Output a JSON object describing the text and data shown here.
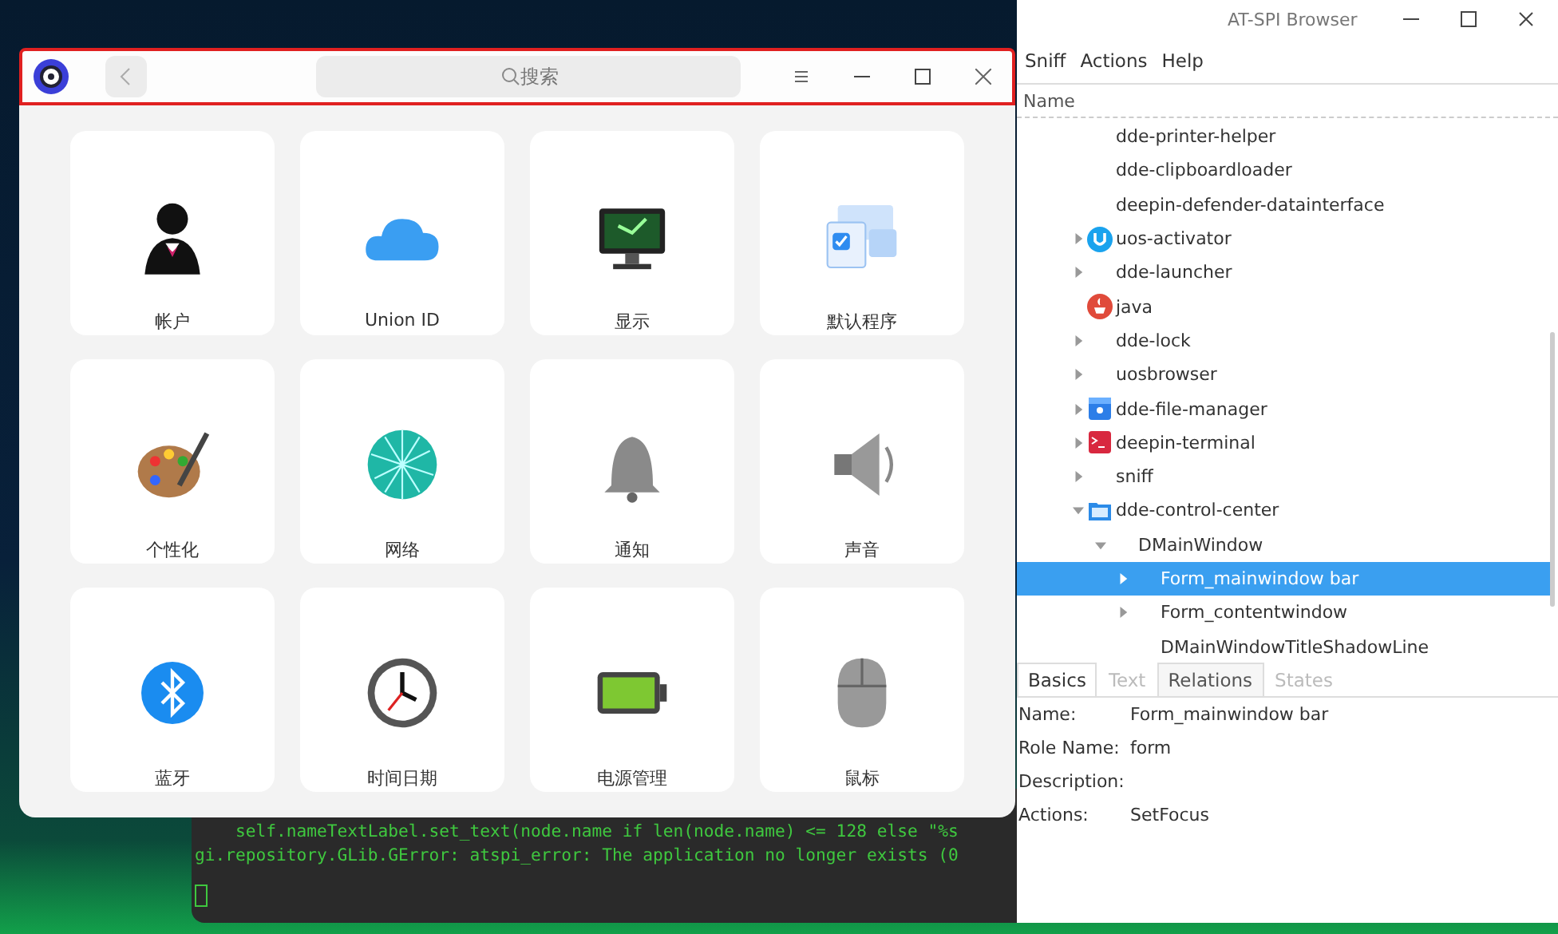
{
  "control_center": {
    "search": {
      "placeholder": "搜索"
    },
    "tiles": [
      {
        "label": "帐户"
      },
      {
        "label": "Union ID"
      },
      {
        "label": "显示"
      },
      {
        "label": "默认程序"
      },
      {
        "label": "个性化"
      },
      {
        "label": "网络"
      },
      {
        "label": "通知"
      },
      {
        "label": "声音"
      },
      {
        "label": "蓝牙"
      },
      {
        "label": "时间日期"
      },
      {
        "label": "电源管理"
      },
      {
        "label": "鼠标"
      }
    ]
  },
  "terminal": {
    "lines": [
      "    self.nameTextLabel.set_text(node.name if len(node.name) <= 128 else \"%s",
      "gi.repository.GLib.GError: atspi_error: The application no longer exists (0"
    ]
  },
  "atspi_browser": {
    "window": {
      "title": "AT-SPI Browser"
    },
    "menu": [
      "Sniff",
      "Actions",
      "Help"
    ],
    "tree": {
      "column": "Name",
      "items": [
        {
          "label": "dde-printer-helper",
          "selected": false
        },
        {
          "label": "dde-clipboardloader",
          "selected": false
        },
        {
          "label": "deepin-defender-datainterface",
          "selected": false
        },
        {
          "label": "uos-activator",
          "kind": "activator",
          "expanded": false,
          "selected": false
        },
        {
          "label": "dde-launcher",
          "expanded": false,
          "selected": false
        },
        {
          "label": "java",
          "kind": "java",
          "selected": false
        },
        {
          "label": "dde-lock",
          "expanded": false,
          "selected": false
        },
        {
          "label": "uosbrowser",
          "expanded": false,
          "selected": false
        },
        {
          "label": "dde-file-manager",
          "kind": "file-manager",
          "expanded": false,
          "selected": false
        },
        {
          "label": "deepin-terminal",
          "kind": "terminal",
          "expanded": false,
          "selected": false
        },
        {
          "label": "sniff",
          "expanded": false,
          "selected": false
        },
        {
          "label": "dde-control-center",
          "kind": "control-center",
          "expanded": true,
          "selected": false,
          "children": [
            {
              "label": "DMainWindow",
              "expanded": true,
              "selected": false,
              "children": [
                {
                  "label": "Form_mainwindow bar",
                  "expanded": false,
                  "selected": true
                },
                {
                  "label": "Form_contentwindow",
                  "expanded": false,
                  "selected": false
                },
                {
                  "label": "DMainWindowTitleShadowLine",
                  "selected": false
                }
              ]
            }
          ]
        }
      ]
    },
    "tabs": [
      {
        "label": "Basics",
        "selected": true,
        "disabled": false
      },
      {
        "label": "Text",
        "selected": false,
        "disabled": true
      },
      {
        "label": "Relations",
        "selected": false,
        "disabled": false
      },
      {
        "label": "States",
        "selected": false,
        "disabled": true
      }
    ],
    "properties": [
      {
        "label": "Name:",
        "value": "Form_mainwindow bar"
      },
      {
        "label": "Role Name:",
        "value": "form"
      },
      {
        "label": "Description:"
      },
      {
        "label": "Actions:",
        "value": "SetFocus"
      }
    ]
  }
}
